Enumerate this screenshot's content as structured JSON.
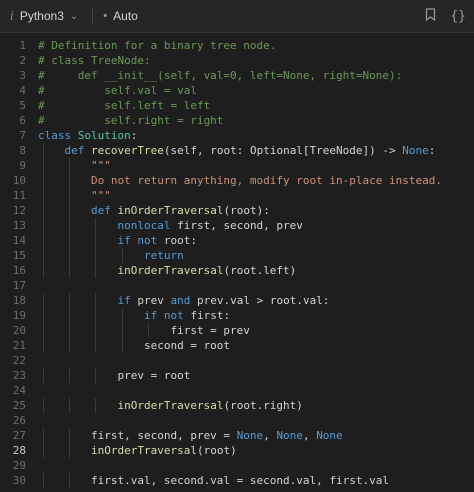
{
  "toolbar": {
    "info_glyph": "i",
    "language": "Python3",
    "mode": "Auto",
    "bookmark_icon": "bookmark-icon",
    "format_icon": "braces-icon",
    "format_label": "{}"
  },
  "editor": {
    "active_line": 28,
    "lines": [
      {
        "n": "1",
        "t": "# Definition for a binary tree node."
      },
      {
        "n": "2",
        "t": "# class TreeNode:"
      },
      {
        "n": "3",
        "t": "#     def __init__(self, val=0, left=None, right=None):"
      },
      {
        "n": "4",
        "t": "#         self.val = val"
      },
      {
        "n": "5",
        "t": "#         self.left = left"
      },
      {
        "n": "6",
        "t": "#         self.right = right"
      },
      {
        "n": "7",
        "t": "class Solution:"
      },
      {
        "n": "8",
        "t": "    def recoverTree(self, root: Optional[TreeNode]) -> None:"
      },
      {
        "n": "9",
        "t": "        \"\"\""
      },
      {
        "n": "10",
        "t": "        Do not return anything, modify root in-place instead."
      },
      {
        "n": "11",
        "t": "        \"\"\""
      },
      {
        "n": "12",
        "t": "        def inOrderTraversal(root):"
      },
      {
        "n": "13",
        "t": "            nonlocal first, second, prev"
      },
      {
        "n": "14",
        "t": "            if not root:"
      },
      {
        "n": "15",
        "t": "                return"
      },
      {
        "n": "16",
        "t": "            inOrderTraversal(root.left)"
      },
      {
        "n": "17",
        "t": ""
      },
      {
        "n": "18",
        "t": "            if prev and prev.val > root.val:"
      },
      {
        "n": "19",
        "t": "                if not first:"
      },
      {
        "n": "20",
        "t": "                    first = prev"
      },
      {
        "n": "21",
        "t": "                second = root"
      },
      {
        "n": "22",
        "t": ""
      },
      {
        "n": "23",
        "t": "            prev = root"
      },
      {
        "n": "24",
        "t": ""
      },
      {
        "n": "25",
        "t": "            inOrderTraversal(root.right)"
      },
      {
        "n": "26",
        "t": ""
      },
      {
        "n": "27",
        "t": "        first, second, prev = None, None, None"
      },
      {
        "n": "28",
        "t": "        inOrderTraversal(root)"
      },
      {
        "n": "29",
        "t": ""
      },
      {
        "n": "30",
        "t": "        first.val, second.val = second.val, first.val"
      }
    ]
  },
  "colors": {
    "keyword": "#569cd6",
    "comment": "#6a9955",
    "string": "#ce9178",
    "function": "#dcdcaa",
    "class": "#4ec9b0",
    "text": "#d4d4d4"
  }
}
